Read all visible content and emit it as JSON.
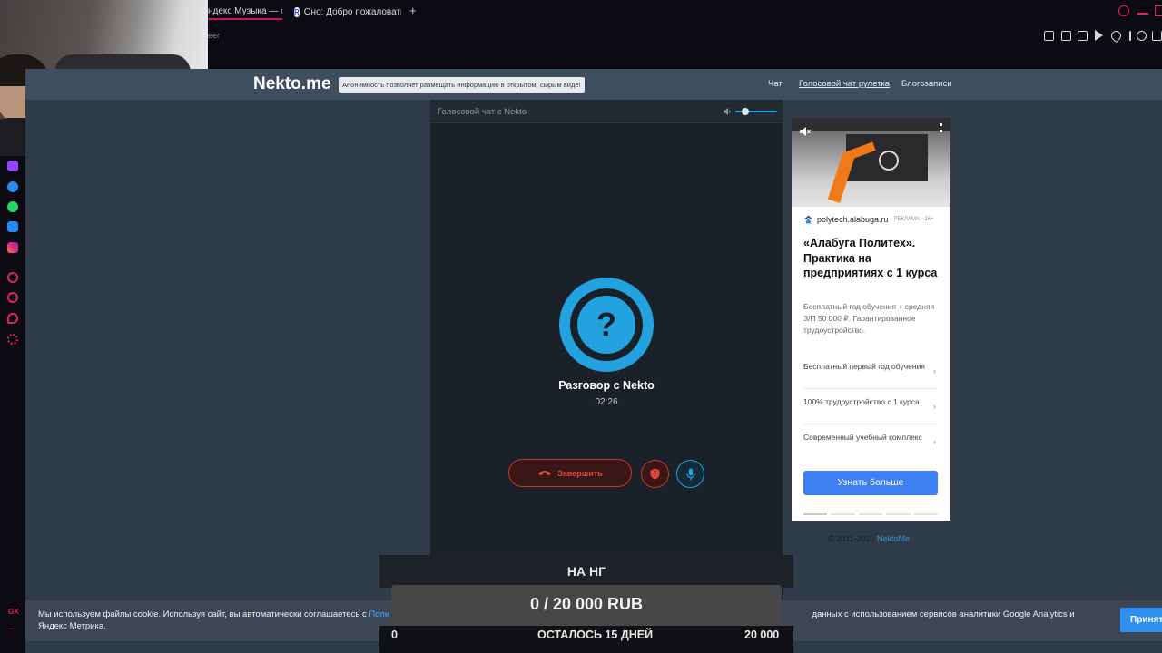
{
  "browser": {
    "tabs": [
      {
        "label": "ндекс Музыка — со"
      },
      {
        "label": "Оно: Добро пожаловать"
      }
    ],
    "new_tab": "+",
    "url_fragment": "eer",
    "toolbar_icons": [
      "bookmark-icon",
      "screenshot-icon",
      "shield-icon",
      "play-icon",
      "heart-icon",
      "menu-icon",
      "account-icon",
      "download-icon"
    ]
  },
  "sidebar": {
    "icons": [
      "twitch-icon",
      "messenger-icon",
      "whatsapp-icon",
      "vk-icon",
      "instagram-icon",
      "player-icon",
      "history-icon",
      "chat-icon",
      "settings-icon"
    ],
    "gx_label": "GX",
    "more_label": "..."
  },
  "site": {
    "logo": "Nekto.me",
    "slogan": "Анонимность позволяет размещать информацию в открытом, сырым виде!",
    "nav": [
      {
        "label": "Чат"
      },
      {
        "label": "Голосовой чат рулетка"
      },
      {
        "label": "Блогозаписи"
      }
    ]
  },
  "chat": {
    "header_title": "Голосовой чат с Nekto",
    "avatar_symbol": "?",
    "conversation_title": "Разговор с Nekto",
    "timer": "02:26",
    "end_button": "Завершить",
    "volume_level": 0.2
  },
  "ad": {
    "domain": "polytech.alabuga.ru",
    "label": "РЕКЛАМА · 16+",
    "title": "«Алабуга Политех». Практика на предприятиях с 1 курса",
    "description": "Бесплатный год обучения + средняя З/П 50 000 ₽. Гарантированное трудоустройство.",
    "items": [
      {
        "text": "Бесплатный первый год обучения"
      },
      {
        "text": "100% трудоустройство с 1 курса"
      },
      {
        "text": "Современный учебный комплекс"
      }
    ],
    "button": "Узнать больше"
  },
  "footer": {
    "copyright": "© 2011-2025",
    "brand": "NektoMe"
  },
  "cookie": {
    "text_start": "Мы используем файлы cookie. Используя сайт, вы автоматически соглашаетесь с",
    "link": "Поли",
    "text_end": "данных с использованием сервисов аналитики Google Analytics и Яндекс Метрика.",
    "accept_button": "Принять"
  },
  "donation": {
    "title": "НА НГ",
    "amount": "0 / 20 000 RUB",
    "min": "0",
    "remaining": "ОСТАЛОСЬ 15 ДНЕЙ",
    "max": "20 000",
    "progress": 0
  }
}
